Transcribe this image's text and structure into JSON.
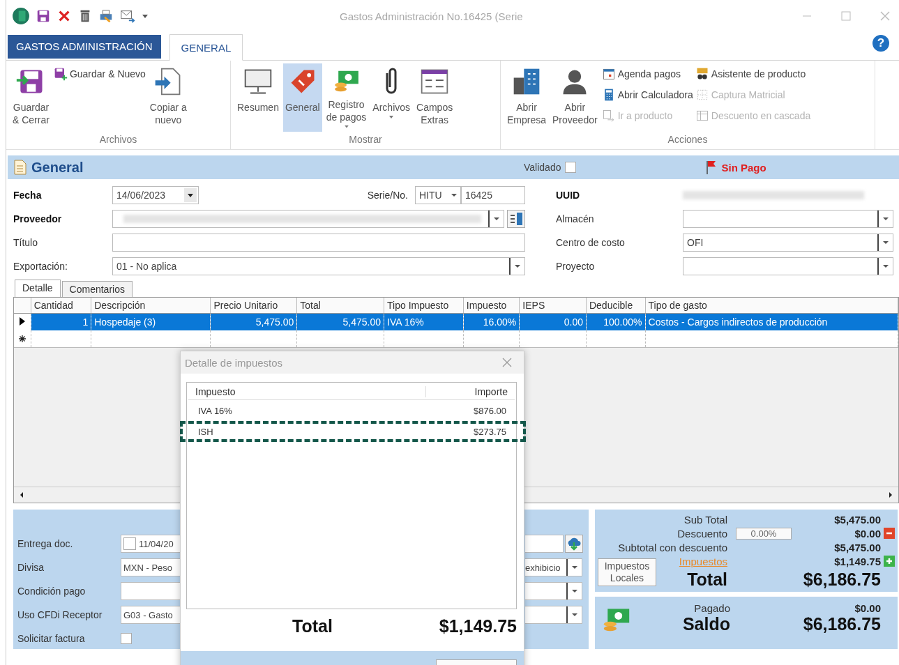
{
  "window": {
    "title": "Gastos Administración No.16425 (Serie"
  },
  "ribbon_tabs": [
    {
      "label": "GASTOS ADMINISTRACIÓN",
      "kind": "app",
      "selected": false
    },
    {
      "label": "GENERAL",
      "kind": "tab",
      "selected": true
    }
  ],
  "help": "?",
  "ribbon_groups": [
    {
      "label": "Archivos",
      "columns": [
        {
          "kind": "large",
          "label": "Guardar\n& Cerrar",
          "selected": false,
          "dropdown": false
        },
        {
          "kind": "stack",
          "items": [
            {
              "label": "Guardar & Nuevo",
              "disabled": false
            }
          ]
        },
        {
          "kind": "large",
          "label": "Copiar a\nnuevo",
          "selected": false,
          "dropdown": false
        }
      ]
    },
    {
      "label": "Mostrar",
      "columns": [
        {
          "kind": "large",
          "label": "Resumen",
          "selected": false,
          "dropdown": false
        },
        {
          "kind": "large",
          "label": "General",
          "selected": true,
          "dropdown": false
        },
        {
          "kind": "large",
          "label": "Registro\nde pagos",
          "selected": false,
          "dropdown": true
        },
        {
          "kind": "large",
          "label": "Archivos",
          "selected": false,
          "dropdown": true
        },
        {
          "kind": "large",
          "label": "Campos\nExtras",
          "selected": false,
          "dropdown": false
        }
      ]
    },
    {
      "label": "Acciones",
      "columns": [
        {
          "kind": "large",
          "label": "Abrir\nEmpresa",
          "selected": false,
          "dropdown": false
        },
        {
          "kind": "large",
          "label": "Abrir\nProveedor",
          "selected": false,
          "dropdown": false
        },
        {
          "kind": "stack",
          "items": [
            {
              "label": "Agenda pagos",
              "disabled": false
            },
            {
              "label": "Abrir Calculadora",
              "disabled": false
            },
            {
              "label": "Ir a producto",
              "disabled": true
            }
          ]
        },
        {
          "kind": "stack",
          "items": [
            {
              "label": "Asistente de producto",
              "disabled": false
            },
            {
              "label": "Captura Matricial",
              "disabled": true
            },
            {
              "label": "Descuento en cascada",
              "disabled": true
            }
          ]
        }
      ]
    }
  ],
  "section": {
    "title": "General",
    "validated": {
      "label": "Validado",
      "checked": false
    },
    "status": {
      "label": "Sin Pago"
    }
  },
  "form_left": [
    {
      "label": "Fecha",
      "required": true,
      "kind": "date",
      "value": "14/06/2023"
    },
    {
      "label": "Proveedor",
      "required": true,
      "kind": "lookup"
    },
    {
      "label": "Título",
      "required": false,
      "kind": "text"
    },
    {
      "label": "Exportación:",
      "required": false,
      "kind": "combo",
      "value": "01 - No aplica"
    }
  ],
  "serie": {
    "label": "Serie/No.",
    "series": "HITU",
    "number": "16425"
  },
  "form_right": [
    {
      "label": "UUID",
      "required": true,
      "kind": "redacted"
    },
    {
      "label": "Almacén",
      "required": false,
      "kind": "combo"
    },
    {
      "label": "Centro de costo",
      "required": false,
      "kind": "combo",
      "value": "OFI"
    },
    {
      "label": "Proyecto",
      "required": false,
      "kind": "combo"
    }
  ],
  "detail_tabs": [
    {
      "label": "Detalle",
      "selected": true
    },
    {
      "label": "Comentarios",
      "selected": false
    }
  ],
  "grid": {
    "columns": [
      {
        "label": "Cantidad",
        "kind": "number"
      },
      {
        "label": "Descripción",
        "kind": "text"
      },
      {
        "label": "Precio Unitario",
        "kind": "number"
      },
      {
        "label": "Total",
        "kind": "number"
      },
      {
        "label": "Tipo Impuesto",
        "kind": "text"
      },
      {
        "label": "Impuesto",
        "kind": "number"
      },
      {
        "label": "IEPS",
        "kind": "number"
      },
      {
        "label": "Deducible",
        "kind": "number"
      },
      {
        "label": "Tipo de gasto",
        "kind": "text"
      }
    ],
    "rows": [
      {
        "selected": true,
        "cells": [
          "1",
          "Hospedaje (3)",
          "5,475.00",
          "5,475.00",
          "IVA 16%",
          "16.00%",
          "0.00",
          "100.00%",
          "Costos - Cargos indirectos de producción"
        ]
      }
    ]
  },
  "delivery_fields": [
    {
      "label": "Entrega doc.",
      "kind": "date-check",
      "value": "11/04/20",
      "checked": false
    },
    {
      "label": "Divisa",
      "kind": "combo",
      "value": "MXN - Peso"
    },
    {
      "label": "Condición pago",
      "kind": "text"
    },
    {
      "label": "Uso CFDi Receptor",
      "kind": "combo",
      "value": "G03 - Gasto"
    },
    {
      "label": "Solicitar factura",
      "kind": "check",
      "checked": false
    }
  ],
  "side_fields": [
    {
      "kind": "upload"
    },
    {
      "kind": "combo",
      "value": "exhibicio"
    },
    {
      "kind": "combo"
    },
    {
      "kind": "combo"
    }
  ],
  "totals": {
    "rows": [
      {
        "label": "Sub Total",
        "kind": "plain",
        "value": "$5,475.00"
      },
      {
        "label": "Descuento",
        "kind": "input",
        "input": "0.00%",
        "value": "$0.00"
      },
      {
        "label": "Subtotal con descuento",
        "kind": "plain",
        "value": "$5,475.00"
      },
      {
        "label": "Impuestos",
        "kind": "link",
        "value": "$1,149.75"
      }
    ],
    "local_taxes_button": "Impuestos Locales",
    "total": {
      "label": "Total",
      "value": "$6,186.75"
    }
  },
  "payment": {
    "paid": {
      "label": "Pagado",
      "value": "$0.00"
    },
    "balance": {
      "label": "Saldo",
      "value": "$6,186.75"
    }
  },
  "dialog": {
    "title": "Detalle de impuestos",
    "columns": [
      "Impuesto",
      "Importe"
    ],
    "rows": [
      {
        "name": "IVA 16%",
        "amount": "$876.00",
        "highlighted": false
      },
      {
        "name": "ISH",
        "amount": "$273.75",
        "highlighted": true
      }
    ],
    "total": {
      "label": "Total",
      "value": "$1,149.75"
    }
  }
}
